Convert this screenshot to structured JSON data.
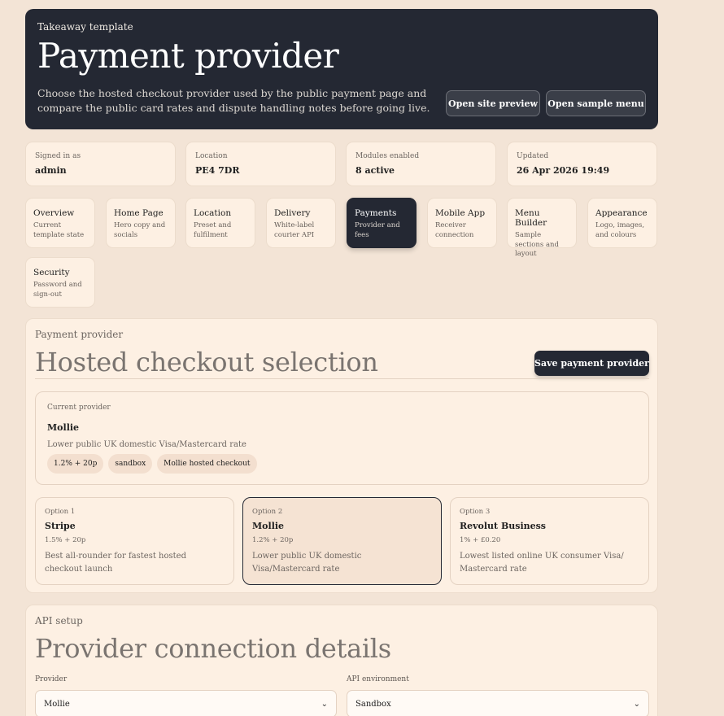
{
  "hero": {
    "kicker": "Takeaway template",
    "title": "Payment provider",
    "description": "Choose the hosted checkout provider used by the public payment page and compare the public card rates and dispute handling notes before going live.",
    "preview_button": "Open site preview",
    "menu_button": "Open sample menu"
  },
  "stats": [
    {
      "label": "Signed in as",
      "value": "admin"
    },
    {
      "label": "Location",
      "value": "PE4 7DR"
    },
    {
      "label": "Modules enabled",
      "value": "8 active"
    },
    {
      "label": "Updated",
      "value": "26 Apr 2026 19:49"
    }
  ],
  "nav": [
    {
      "title": "Overview",
      "desc": "Current template state"
    },
    {
      "title": "Home Page",
      "desc": "Hero copy and socials"
    },
    {
      "title": "Location",
      "desc": "Preset and fulfilment"
    },
    {
      "title": "Delivery",
      "desc": "White-label courier API"
    },
    {
      "title": "Payments",
      "desc": "Provider and fees",
      "active": true
    },
    {
      "title": "Mobile App",
      "desc": "Receiver connection"
    },
    {
      "title": "Menu Builder",
      "desc": "Sample sections and layout"
    },
    {
      "title": "Appearance",
      "desc": "Logo, images, and colours"
    },
    {
      "title": "Security",
      "desc": "Password and sign-out"
    }
  ],
  "provider": {
    "section_label": "Payment provider",
    "heading": "Hosted checkout selection",
    "save_button": "Save payment provider",
    "current": {
      "label": "Current provider",
      "name": "Mollie",
      "desc": "Lower public UK domestic Visa/Mastercard rate",
      "chips": [
        "1.2% + 20p",
        "sandbox",
        "Mollie hosted checkout"
      ]
    },
    "options": [
      {
        "label": "Option 1",
        "name": "Stripe",
        "fee": "1.5% + 20p",
        "desc": "Best all-rounder for fastest hosted checkout launch"
      },
      {
        "label": "Option 2",
        "name": "Mollie",
        "fee": "1.2% + 20p",
        "desc": "Lower public UK domestic Visa/Mastercard rate",
        "selected": true
      },
      {
        "label": "Option 3",
        "name": "Revolut Business",
        "fee": "1% + £0.20",
        "desc": "Lowest listed online UK consumer Visa/ Mastercard rate"
      }
    ]
  },
  "api": {
    "section_label": "API setup",
    "heading": "Provider connection details",
    "provider_label": "Provider",
    "provider_value": "Mollie",
    "env_label": "API environment",
    "env_value": "Sandbox"
  },
  "colors": {
    "dark": "#242833",
    "background": "#f3e4d6",
    "card": "#fdf0e3",
    "chip": "#f3dfcf"
  }
}
